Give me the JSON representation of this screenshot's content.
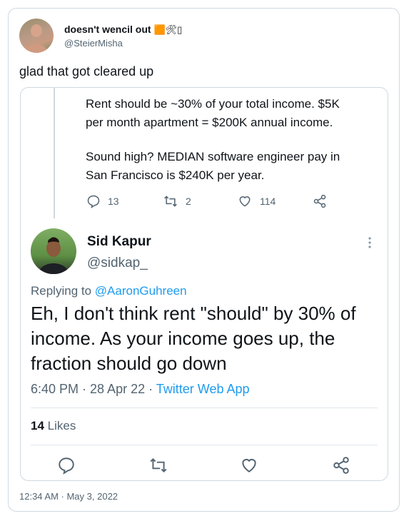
{
  "outer": {
    "author_name": "doesn't wencil out",
    "author_emoji": "🟧🛠▯",
    "author_handle": "@SteierMisha",
    "text": "glad that got cleared up",
    "timestamp": "12:34 AM · May 3, 2022"
  },
  "quoted_parent": {
    "text_line1": "Rent should be ~30% of your total income. $5K",
    "text_line2": "per month apartment = $200K annual income.",
    "text_line3": "Sound high? MEDIAN software engineer pay in",
    "text_line4": "San Francisco is $240K per year.",
    "replies": "13",
    "retweets": "2",
    "likes": "114"
  },
  "reply": {
    "author_name": "Sid Kapur",
    "author_handle": "@sidkap_",
    "replying_prefix": "Replying to",
    "replying_to": "@AaronGuhreen",
    "text_line1": "Eh, I don't think rent \"should\" by 30% of",
    "text_line2": "income. As your income goes up, the",
    "text_line3": "fraction should go down",
    "time_date": "6:40 PM · 28 Apr 22 ·",
    "source": "Twitter Web App",
    "likes_count": "14",
    "likes_label": "Likes"
  },
  "colors": {
    "accent": "#1d9bf0",
    "border": "#cfd9de",
    "muted": "#536471"
  }
}
